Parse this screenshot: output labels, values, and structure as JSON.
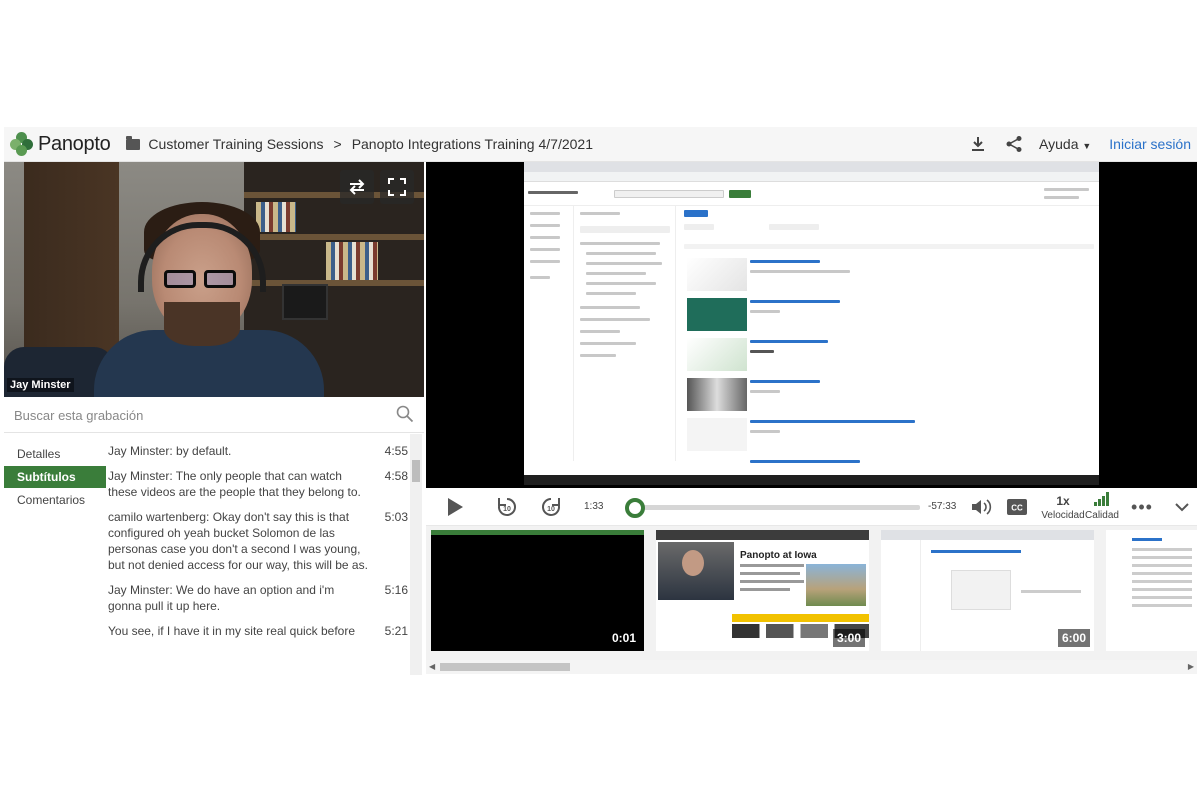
{
  "app": {
    "logo_text": "Panopto",
    "breadcrumb": [
      "Customer Training Sessions",
      "Panopto Integrations Training 4/7/2021"
    ],
    "help_label": "Ayuda",
    "login_label": "Iniciar sesión"
  },
  "webcam": {
    "speaker_name": "Jay Minster"
  },
  "search": {
    "placeholder": "Buscar esta grabación"
  },
  "tabs": [
    {
      "label": "Detalles",
      "active": false
    },
    {
      "label": "Subtítulos",
      "active": true
    },
    {
      "label": "Comentarios",
      "active": false
    }
  ],
  "transcript": [
    {
      "text": "Jay Minster: by default.",
      "time": "4:55"
    },
    {
      "text": "Jay Minster: The only people that can watch these videos are the people that they belong to.",
      "time": "4:58"
    },
    {
      "text": "camilo wartenberg: Okay don't say this is that configured oh yeah bucket Solomon de las personas case you don't a second I was young, but not denied access for our way, this will be as.",
      "time": "5:03"
    },
    {
      "text": "Jay Minster: We do have an option and i'm gonna pull it up here.",
      "time": "5:16"
    },
    {
      "text": "You see, if I have it in my site real quick before",
      "time": "5:21"
    }
  ],
  "player": {
    "elapsed": "1:33",
    "remaining": "-57:33",
    "progress_fraction": 0.03,
    "speed_value": "1x",
    "speed_label": "Velocidad",
    "quality_label": "Calidad",
    "skip_back_seconds": "10",
    "skip_forward_seconds": "10"
  },
  "thumbnails": [
    {
      "time": "0:01"
    },
    {
      "time": "3:00",
      "title": "Panopto at Iowa"
    },
    {
      "time": "6:00"
    },
    {
      "time": ""
    }
  ],
  "colors": {
    "accent": "#3a7d3a",
    "link": "#2b72c9"
  }
}
